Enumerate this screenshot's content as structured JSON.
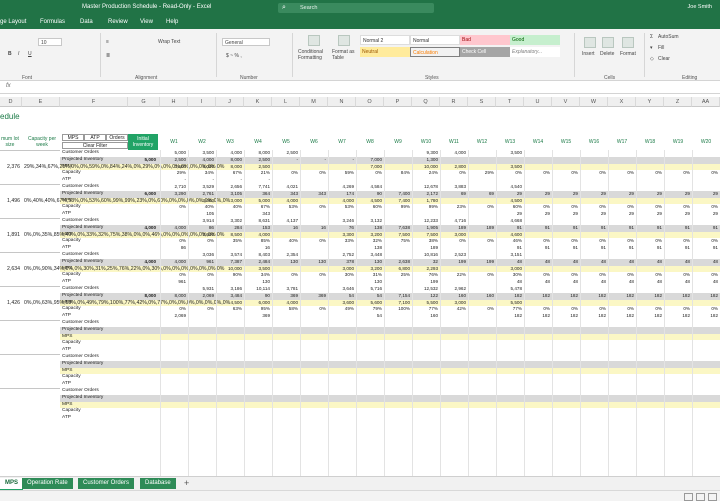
{
  "titlebar": {
    "title": "Master Production Schedule  -  Read-Only  -  Excel",
    "search_placeholder": "Search",
    "user": "Joe Smith"
  },
  "menu": [
    "ge Layout",
    "Formulas",
    "Data",
    "Review",
    "View",
    "Help"
  ],
  "ribbon": {
    "font_size": "10",
    "wrap_text": "Wrap Text",
    "number_format": "General",
    "conditional_formatting": "Conditional Formatting",
    "format_as_table": "Format as Table",
    "styles": [
      "Normal 2",
      "Normal",
      "Bad",
      "Good",
      "Neutral",
      "Calculation",
      "Check Cell",
      "Explanatory..."
    ],
    "cells_buttons": [
      "Insert",
      "Delete",
      "Format"
    ],
    "autosum": "AutoSum",
    "fill": "Fill",
    "clear": "Clear",
    "groups": {
      "font": "Font",
      "alignment": "Alignment",
      "number": "Number",
      "styles": "Styles",
      "cells": "Cells",
      "editing": "Editing"
    }
  },
  "formula_bar": {
    "fx": "fx"
  },
  "columns": [
    "D",
    "E",
    "F",
    "G",
    "H",
    "I",
    "J",
    "K",
    "L",
    "M",
    "N",
    "O",
    "P",
    "Q",
    "R",
    "S",
    "T",
    "U",
    "V",
    "W",
    "X",
    "Y",
    "Z",
    "AA"
  ],
  "sheet": {
    "title": "edule",
    "col_d_header": "mum lot size",
    "col_e_header": "Capacity per week",
    "filter_pills": [
      "MPS",
      "ATP",
      "Orders"
    ],
    "clear_filter": "Clear Filter",
    "initial_inventory": "Initial Inventory",
    "weeks": [
      "W1",
      "W2",
      "W3",
      "W4",
      "W5",
      "W6",
      "W7",
      "W8",
      "W9",
      "W10",
      "W11",
      "W12",
      "W13",
      "W14",
      "W15",
      "W16",
      "W17",
      "W18",
      "W19",
      "W20"
    ],
    "row_labels": [
      "Customer Orders",
      "Projected Inventory",
      "MPS",
      "Capacity",
      "ATP"
    ],
    "products": [
      {
        "lot": "2,376",
        "capacity": [
          "29%",
          "34%",
          "67%",
          "21%",
          "0%",
          "0%",
          "59%",
          "0%",
          "84%",
          "24%",
          "0%",
          "29%",
          "0%",
          "0%",
          "0%",
          "0%",
          "0%",
          "0%",
          "0%",
          "0%"
        ],
        "inventory": "5,000",
        "orders": [
          "5,000",
          "3,500",
          "4,000",
          "8,000",
          "2,500",
          "",
          "",
          "",
          "",
          "9,300",
          "4,000",
          "",
          "3,500",
          "",
          "",
          "",
          "",
          "",
          "",
          ""
        ],
        "projected": [
          "2,500",
          "4,000",
          "8,000",
          "2,500",
          "-",
          "-",
          "-",
          "7,000",
          "",
          "1,300",
          "",
          "",
          "",
          "",
          "",
          "",
          "",
          "",
          "",
          ""
        ],
        "mps": [
          "3,500",
          "4,000",
          "8,000",
          "2,500",
          "",
          "",
          "",
          "7,000",
          "",
          "10,000",
          "2,800",
          "",
          "3,500",
          "",
          "",
          "",
          "",
          "",
          "",
          ""
        ],
        "atp": [
          "-",
          "-",
          "-",
          "-",
          "",
          "",
          "",
          "",
          "",
          "",
          "",
          "",
          "",
          "",
          "",
          "",
          "",
          "",
          "",
          ""
        ]
      },
      {
        "lot": "1,496",
        "capacity": [
          "0%",
          "40%",
          "40%",
          "67%",
          "53%",
          "0%",
          "53%",
          "60%",
          "99%",
          "99%",
          "23%",
          "0%",
          "60%",
          "0%",
          "0%",
          "0%",
          "0%",
          "0%",
          "0%",
          "0%"
        ],
        "inventory": "6,000",
        "orders": [
          "2,710",
          "3,529",
          "2,656",
          "7,741",
          "4,021",
          "",
          "4,269",
          "4,584",
          "",
          "12,678",
          "3,883",
          "",
          "4,540",
          "",
          "",
          "",
          "",
          "",
          "",
          ""
        ],
        "projected": [
          "3,290",
          "2,761",
          "3,105",
          "364",
          "343",
          "343",
          "174",
          "90",
          "7,400",
          "2,172",
          "69",
          "69",
          "29",
          "29",
          "29",
          "29",
          "29",
          "29",
          "29",
          "29"
        ],
        "mps": [
          "",
          "3,000",
          "3,000",
          "5,000",
          "4,000",
          "",
          "4,000",
          "4,500",
          "7,400",
          "1,780",
          "",
          "",
          "4,500",
          "",
          "",
          "",
          "",
          "",
          "",
          ""
        ],
        "atp": [
          "",
          "105",
          "",
          "343",
          "",
          "",
          "",
          "",
          "",
          "",
          "",
          "",
          "29",
          "29",
          "29",
          "29",
          "29",
          "29",
          "29",
          "29"
        ]
      },
      {
        "lot": "1,891",
        "capacity": [
          "0%",
          "0%",
          "35%",
          "85%",
          "40%",
          "0%",
          "33%",
          "32%",
          "75%",
          "38%",
          "0%",
          "0%",
          "46%",
          "0%",
          "0%",
          "0%",
          "0%",
          "0%",
          "0%",
          "0%"
        ],
        "inventory": "4,000",
        "orders": [
          "",
          "3,914",
          "3,302",
          "8,631",
          "4,137",
          "",
          "3,246",
          "3,132",
          "",
          "12,233",
          "4,716",
          "",
          "4,668",
          "",
          "",
          "",
          "",
          "",
          "",
          ""
        ],
        "projected": [
          "4,000",
          "86",
          "284",
          "153",
          "16",
          "16",
          "76",
          "138",
          "7,638",
          "1,905",
          "189",
          "189",
          "91",
          "91",
          "91",
          "91",
          "91",
          "91",
          "91",
          "91"
        ],
        "mps": [
          "",
          "3,500",
          "8,500",
          "4,000",
          "",
          "",
          "3,300",
          "3,200",
          "7,500",
          "7,500",
          "3,000",
          "",
          "4,600",
          "",
          "",
          "",
          "",
          "",
          "",
          ""
        ],
        "atp": [
          "86",
          "",
          "",
          "16",
          "",
          "",
          "",
          "138",
          "",
          "189",
          "",
          "",
          "91",
          "91",
          "91",
          "91",
          "91",
          "91",
          "91",
          "91"
        ]
      },
      {
        "lot": "2,634",
        "capacity": [
          "0%",
          "0%",
          "90%",
          "34%",
          "0%",
          "0%",
          "30%",
          "31%",
          "25%",
          "76%",
          "22%",
          "0%",
          "30%",
          "0%",
          "0%",
          "0%",
          "0%",
          "0%",
          "0%",
          "0%"
        ],
        "inventory": "4,000",
        "orders": [
          "",
          "3,036",
          "3,574",
          "8,403",
          "2,354",
          "",
          "2,752",
          "3,448",
          "",
          "10,816",
          "2,523",
          "",
          "3,151",
          "",
          "",
          "",
          "",
          "",
          "",
          ""
        ],
        "projected": [
          "4,000",
          "961",
          "7,387",
          "2,484",
          "130",
          "130",
          "378",
          "130",
          "2,638",
          "32",
          "199",
          "199",
          "48",
          "48",
          "48",
          "48",
          "48",
          "48",
          "48",
          "48"
        ],
        "mps": [
          "",
          "",
          "10,000",
          "3,500",
          "",
          "",
          "3,000",
          "3,200",
          "6,800",
          "2,293",
          "",
          "",
          "3,000",
          "",
          "",
          "",
          "",
          "",
          "",
          ""
        ],
        "atp": [
          "961",
          "",
          "",
          "130",
          "",
          "",
          "",
          "130",
          "",
          "199",
          "",
          "",
          "48",
          "48",
          "48",
          "48",
          "48",
          "48",
          "48",
          "48"
        ]
      },
      {
        "lot": "1,426",
        "capacity": [
          "0%",
          "0%",
          "63%",
          "95%",
          "58%",
          "0%",
          "49%",
          "79%",
          "100%",
          "77%",
          "42%",
          "0%",
          "77%",
          "0%",
          "0%",
          "0%",
          "0%",
          "0%",
          "0%",
          "0%"
        ],
        "inventory": "8,000",
        "orders": [
          "",
          "5,931",
          "3,186",
          "10,114",
          "3,781",
          "",
          "3,646",
          "5,716",
          "",
          "12,532",
          "2,962",
          "",
          "5,478",
          "",
          "",
          "",
          "",
          "",
          "",
          ""
        ],
        "projected": [
          "8,000",
          "2,069",
          "3,484",
          "90",
          "369",
          "369",
          "54",
          "54",
          "7,154",
          "122",
          "160",
          "160",
          "182",
          "182",
          "182",
          "182",
          "182",
          "182",
          "182",
          "182"
        ],
        "mps": [
          "",
          "",
          "4,500",
          "6,000",
          "4,000",
          "",
          "3,600",
          "5,600",
          "7,100",
          "5,500",
          "3,000",
          "",
          "5,500",
          "",
          "",
          "",
          "",
          "",
          "",
          ""
        ],
        "atp": [
          "2,069",
          "",
          "",
          "369",
          "",
          "",
          "",
          "54",
          "",
          "160",
          "",
          "",
          "182",
          "182",
          "182",
          "182",
          "182",
          "182",
          "182",
          "182"
        ]
      }
    ],
    "empty_blocks": 3
  },
  "tabs": [
    "MPS",
    "Operation Rate",
    "Customer Orders",
    "Database"
  ],
  "tab_add": "+",
  "colors": {
    "excel_green": "#217346",
    "mps_fill": "#fbf7c5",
    "projected_fill": "#d9d9d9",
    "tab_green": "#2e8b57"
  }
}
